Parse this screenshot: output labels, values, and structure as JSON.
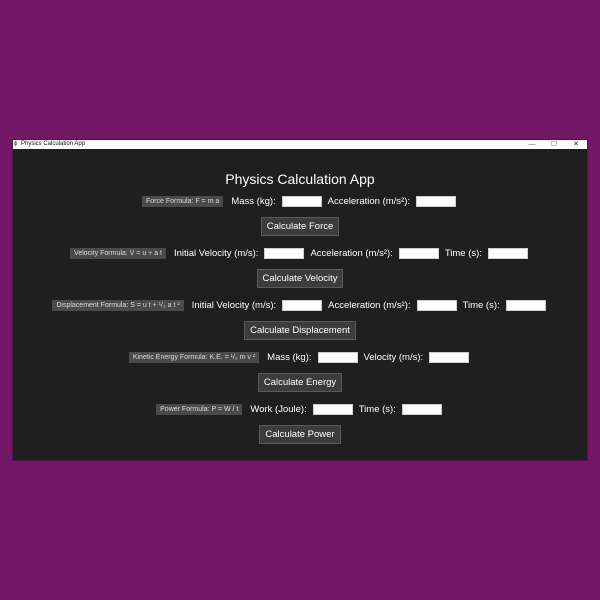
{
  "window": {
    "title": "Physics Calculation App",
    "controls": {
      "minimize": "—",
      "maximize": "☐",
      "close": "✕"
    }
  },
  "app": {
    "heading": "Physics Calculation App"
  },
  "force": {
    "formula": "Force Formula: F = m a",
    "mass_label": "Mass (kg):",
    "acceleration_label": "Acceleration (m/s²):",
    "button": "Calculate Force"
  },
  "velocity": {
    "formula": "Velocity Formula: V = u + a t",
    "initial_velocity_label": "Initial Velocity (m/s):",
    "acceleration_label": "Acceleration (m/s²):",
    "time_label": "Time (s):",
    "button": "Calculate Velocity"
  },
  "displacement": {
    "formula": "Displacement Formula: S = u t + ¹/₂ a t ²",
    "initial_velocity_label": "Initial Velocity (m/s):",
    "acceleration_label": "Acceleration (m/s²):",
    "time_label": "Time (s):",
    "button": "Calculate Displacement"
  },
  "energy": {
    "formula": "Kinetic Energy Formula: K.E. = ¹/₂ m v ²",
    "mass_label": "Mass (kg):",
    "velocity_label": "Velocity (m/s):",
    "button": "Calculate Energy"
  },
  "power": {
    "formula": "Power Formula: P = W / t",
    "work_label": "Work (Joule):",
    "time_label": "Time (s):",
    "button": "Calculate Power"
  }
}
